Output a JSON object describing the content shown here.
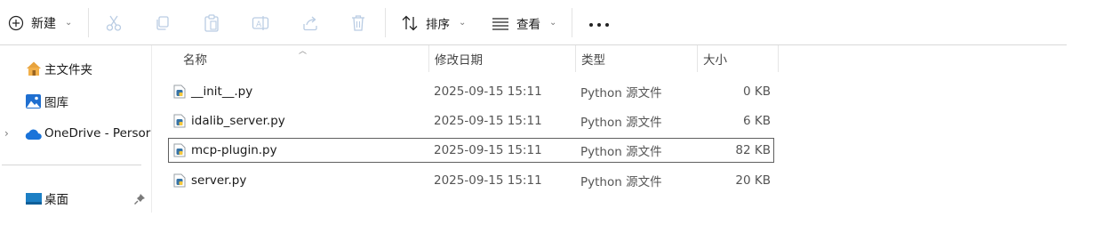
{
  "toolbar": {
    "new_label": "新建",
    "sort_label": "排序",
    "view_label": "查看",
    "icons": [
      "plus-circle-icon",
      "cut-icon",
      "copy-icon",
      "paste-icon",
      "rename-icon",
      "share-icon",
      "delete-icon",
      "sort-icon",
      "view-icon",
      "more-icon"
    ]
  },
  "sidebar": {
    "items": [
      {
        "label": "主文件夹",
        "icon": "home-icon"
      },
      {
        "label": "图库",
        "icon": "gallery-icon"
      },
      {
        "label": "OneDrive - Persor",
        "icon": "onedrive-cloud-icon",
        "expandable": true
      },
      {
        "label": "桌面",
        "icon": "desktop-icon",
        "pinned": true
      }
    ]
  },
  "columns": {
    "name": "名称",
    "date": "修改日期",
    "type": "类型",
    "size": "大小"
  },
  "files": [
    {
      "name": "__init__.py",
      "date": "2025-09-15 15:11",
      "type": "Python 源文件",
      "size": "0 KB",
      "selected": false
    },
    {
      "name": "idalib_server.py",
      "date": "2025-09-15 15:11",
      "type": "Python 源文件",
      "size": "6 KB",
      "selected": false
    },
    {
      "name": "mcp-plugin.py",
      "date": "2025-09-15 15:11",
      "type": "Python 源文件",
      "size": "82 KB",
      "selected": true
    },
    {
      "name": "server.py",
      "date": "2025-09-15 15:11",
      "type": "Python 源文件",
      "size": "20 KB",
      "selected": false
    }
  ],
  "colors": {
    "accent": "#0067c0",
    "selection_border": "#5f5f5f",
    "home_icon": "#e8a33d",
    "onedrive": "#1a73d9",
    "python_blue": "#3572a5"
  }
}
